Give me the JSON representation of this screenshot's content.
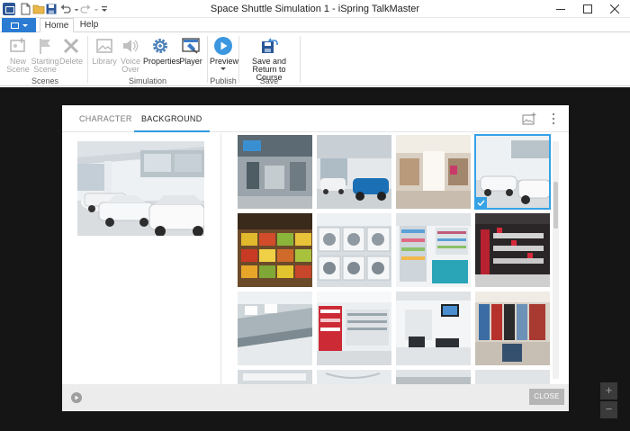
{
  "window": {
    "title": "Space Shuttle Simulation 1 - iSpring TalkMaster"
  },
  "ribbon_tabs": {
    "home": "Home",
    "help": "Help"
  },
  "ribbon": {
    "scenes": {
      "label": "Scenes",
      "new_scene": "New Scene",
      "starting_scene": "Starting Scene",
      "delete": "Delete"
    },
    "simulation": {
      "label": "Simulation",
      "library": "Library",
      "voice_over": "Voice Over",
      "properties": "Properties",
      "player": "Player"
    },
    "publish": {
      "label": "Publish",
      "preview": "Preview"
    },
    "save": {
      "label": "Save",
      "save_return": "Save and Return to Course"
    }
  },
  "dialog": {
    "tabs": {
      "character": "CHARACTER",
      "background": "BACKGROUND"
    },
    "close_label": "CLOSE",
    "selected_background": "car showroom",
    "thumbnails": [
      "city store",
      "car showroom blue",
      "mall",
      "car showroom white",
      "fruit market",
      "washing machines",
      "pharmacy",
      "electronics store",
      "supermarket aisle",
      "appliance store",
      "office",
      "clothing store",
      "interior",
      "mall ceiling",
      "interior",
      "interior"
    ]
  },
  "zoom": {
    "in": "+",
    "out": "−"
  },
  "colors": {
    "accent": "#2b9be0",
    "file_button": "#2b7bd3",
    "workspace": "#151515"
  }
}
